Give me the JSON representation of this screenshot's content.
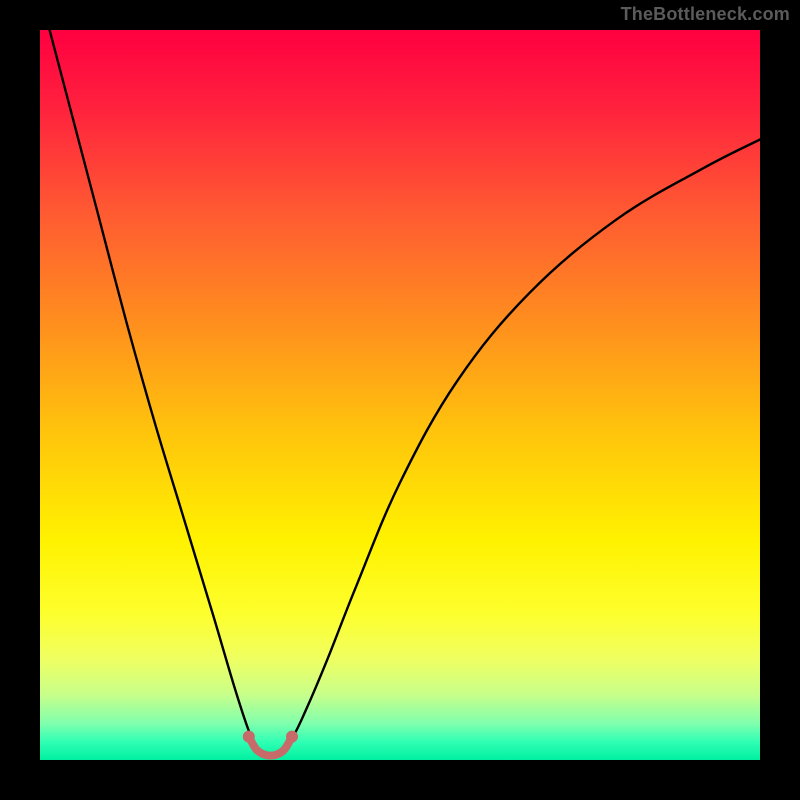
{
  "watermark": "TheBottleneck.com",
  "chart_data": {
    "type": "line",
    "title": "",
    "xlabel": "",
    "ylabel": "",
    "xlim": [
      0,
      100
    ],
    "ylim": [
      0,
      100
    ],
    "background_gradient": {
      "type": "vertical",
      "stops": [
        {
          "pos": 0.0,
          "color": "#ff0040"
        },
        {
          "pos": 0.1,
          "color": "#ff1f3e"
        },
        {
          "pos": 0.25,
          "color": "#ff5a32"
        },
        {
          "pos": 0.4,
          "color": "#ff8e1e"
        },
        {
          "pos": 0.55,
          "color": "#ffc40c"
        },
        {
          "pos": 0.7,
          "color": "#fff200"
        },
        {
          "pos": 0.8,
          "color": "#fdff2d"
        },
        {
          "pos": 0.86,
          "color": "#f0ff60"
        },
        {
          "pos": 0.91,
          "color": "#c8ff8a"
        },
        {
          "pos": 0.95,
          "color": "#80ffad"
        },
        {
          "pos": 0.975,
          "color": "#30ffb4"
        },
        {
          "pos": 1.0,
          "color": "#00f0a0"
        }
      ]
    },
    "series": [
      {
        "name": "bottleneck-curve",
        "color": "#000000",
        "x": [
          0,
          4,
          8,
          12,
          16,
          20,
          24,
          27,
          29,
          30.5,
          31.5,
          33,
          35,
          37,
          40,
          44,
          50,
          58,
          68,
          80,
          92,
          100
        ],
        "y": [
          105,
          90,
          75,
          60,
          46,
          33,
          20,
          10,
          4,
          1,
          0.5,
          1,
          3,
          7,
          14,
          24,
          38,
          52,
          64,
          74,
          81,
          85
        ]
      }
    ],
    "markers": {
      "name": "trough-markers",
      "color": "#c76a6a",
      "radius": 6,
      "points": [
        {
          "x": 29.0,
          "y": 3.2
        },
        {
          "x": 30.0,
          "y": 1.5
        },
        {
          "x": 31.0,
          "y": 0.8
        },
        {
          "x": 32.0,
          "y": 0.6
        },
        {
          "x": 33.0,
          "y": 0.8
        },
        {
          "x": 34.0,
          "y": 1.5
        },
        {
          "x": 35.0,
          "y": 3.2
        }
      ]
    }
  }
}
